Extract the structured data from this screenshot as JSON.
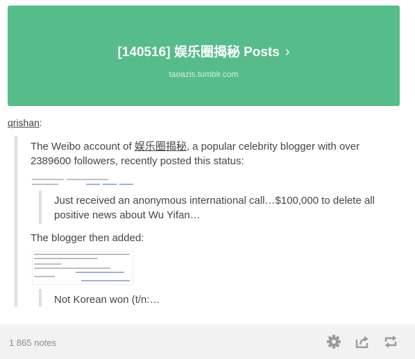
{
  "banner": {
    "title": "[140516] 娱乐圈揭秘 Posts",
    "chevron": "›",
    "url": "taoazis.tumblr.com"
  },
  "post": {
    "username": "qrishan",
    "username_suffix": ":",
    "para1_before": "The Weibo account of ",
    "para1_link": "娱乐圈揭秘",
    "para1_after": ", a popular celebrity blogger with over 2389600 followers, recently posted this status:",
    "quote1": "Just received an anonymous international call…$100,000 to delete all positive news about Wu Yifan…",
    "para2": "The blogger then added:",
    "quote2": "Not Korean won (t/n:…"
  },
  "footer": {
    "notes": "1 865 notes",
    "icons": [
      "gear-icon",
      "share-icon",
      "reblog-icon"
    ]
  },
  "colors": {
    "banner": "#56bc8a",
    "text": "#444444",
    "footer_bg": "#f2f2f2"
  }
}
